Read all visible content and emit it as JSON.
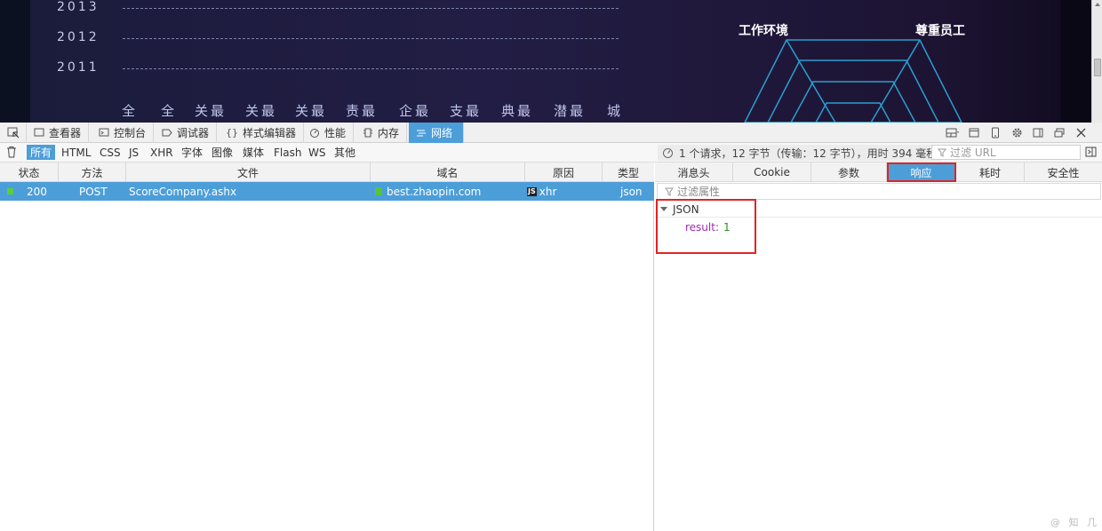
{
  "page": {
    "years": [
      "2013",
      "2012",
      "2011"
    ],
    "category_labels": [
      "全",
      "全",
      "关最",
      "关最",
      "关最",
      "责最",
      "企最",
      "支最",
      "典最",
      "潜最",
      "城"
    ],
    "radar_titles": [
      "工作环境",
      "尊重员工"
    ]
  },
  "toolbar": {
    "tabs": [
      {
        "label": "查看器",
        "icon": "inspector-icon"
      },
      {
        "label": "控制台",
        "icon": "console-icon"
      },
      {
        "label": "调试器",
        "icon": "debugger-icon"
      },
      {
        "label": "样式编辑器",
        "icon": "style-editor-icon"
      },
      {
        "label": "性能",
        "icon": "performance-icon"
      },
      {
        "label": "内存",
        "icon": "memory-icon"
      },
      {
        "label": "网络",
        "icon": "network-icon",
        "active": true
      }
    ]
  },
  "filter": {
    "types": [
      "所有",
      "HTML",
      "CSS",
      "JS",
      "XHR",
      "字体",
      "图像",
      "媒体",
      "Flash",
      "WS",
      "其他"
    ],
    "summary": "1 个请求，12 字节（传输：12 字节），用时 394 毫秒",
    "url_placeholder": "过滤 URL"
  },
  "list": {
    "columns": [
      "状态",
      "方法",
      "文件",
      "域名",
      "原因",
      "类型"
    ],
    "row": {
      "status": "200",
      "method": "POST",
      "file": "ScoreCompany.ashx",
      "domain": "best.zhaopin.com",
      "cause": "xhr",
      "type": "json"
    }
  },
  "detail": {
    "tabs": [
      "消息头",
      "Cookie",
      "参数",
      "响应",
      "耗时",
      "安全性"
    ],
    "active_tab": "响应",
    "filter_placeholder": "过滤属性",
    "json_label": "JSON",
    "json_key": "result",
    "json_value": "1"
  },
  "colors": {
    "accent": "#4c9ed9",
    "highlight": "#e02424",
    "json_key": "#a32ab2",
    "json_value": "#2e8b1e"
  },
  "watermark": "@ 知 几"
}
